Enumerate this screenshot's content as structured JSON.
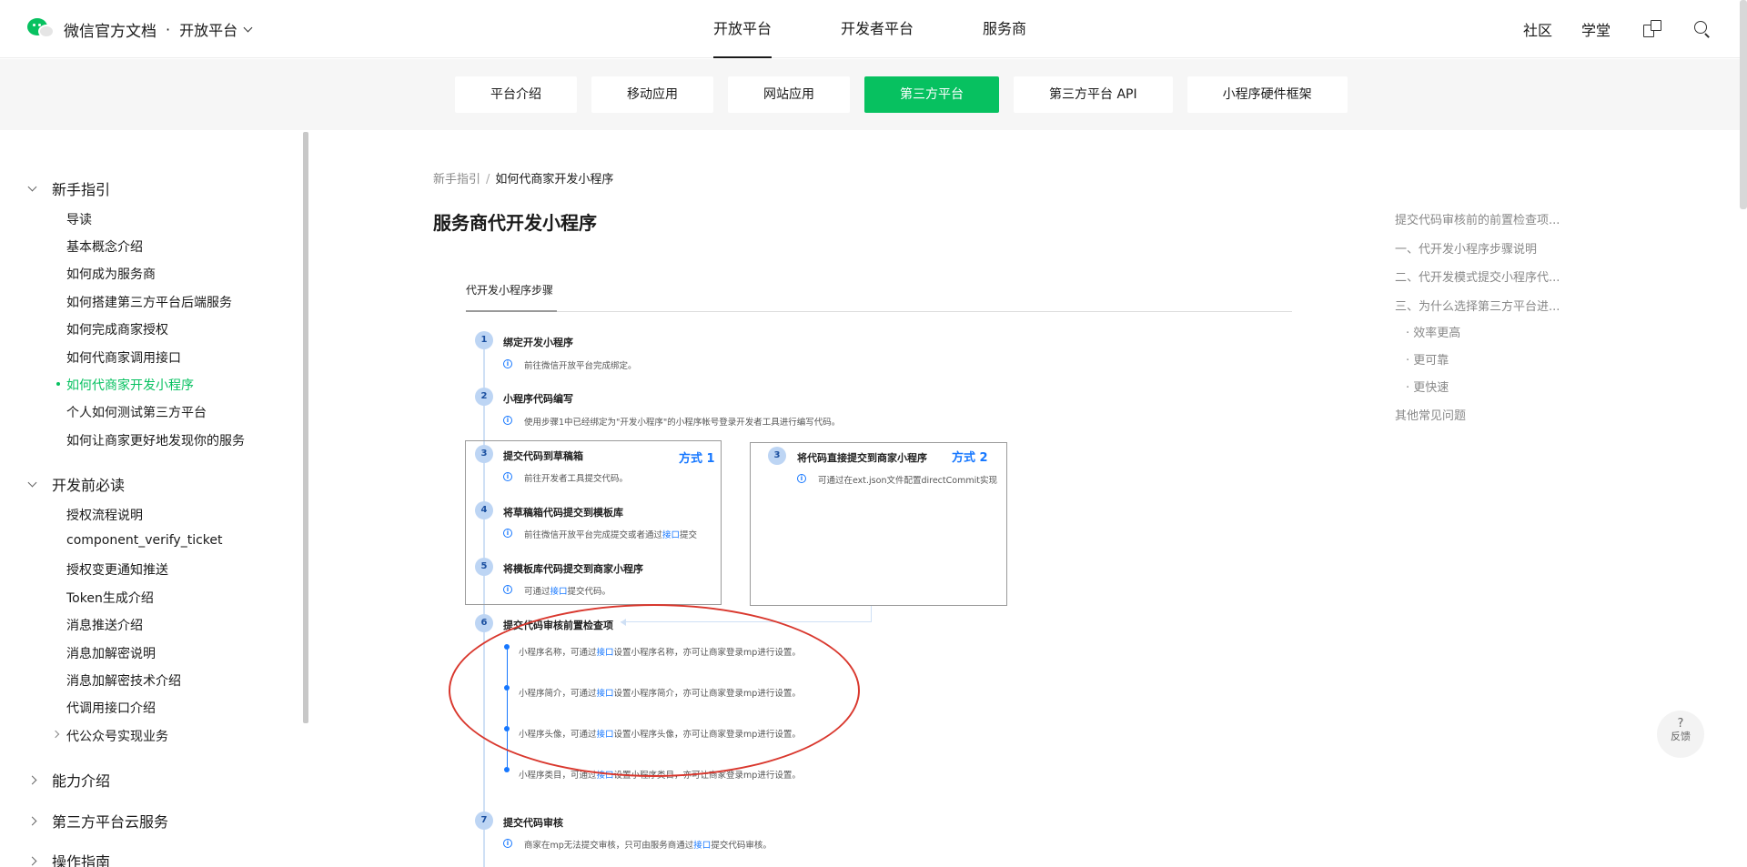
{
  "header": {
    "brand_title": "微信官方文档",
    "brand_sep": "·",
    "platform_switch": "开放平台",
    "nav": [
      "开放平台",
      "开发者平台",
      "服务商"
    ],
    "right_links": [
      "社区",
      "学堂"
    ],
    "icons": [
      "translate-icon",
      "search-icon"
    ]
  },
  "subnav": {
    "tabs": [
      "平台介绍",
      "移动应用",
      "网站应用",
      "第三方平台",
      "第三方平台 API",
      "小程序硬件框架"
    ],
    "active": "第三方平台"
  },
  "sidebar": {
    "groups": [
      {
        "label": "新手指引",
        "expanded": true
      },
      {
        "label": "开发前必读",
        "expanded": true
      },
      {
        "label": "能力介绍",
        "expanded": false
      },
      {
        "label": "第三方平台云服务",
        "expanded": false
      },
      {
        "label": "操作指南",
        "expanded": false
      }
    ],
    "group1_items": [
      "导读",
      "基本概念介绍",
      "如何成为服务商",
      "如何搭建第三方平台后端服务",
      "如何完成商家授权",
      "如何代商家调用接口",
      "如何代商家开发小程序",
      "个人如何测试第三方平台",
      "如何让商家更好地发现你的服务"
    ],
    "group2_items": [
      "授权流程说明",
      "component_verify_ticket",
      "授权变更通知推送",
      "Token生成介绍",
      "消息推送介绍",
      "消息加解密说明",
      "消息加解密技术介绍",
      "代调用接口介绍",
      "代公众号实现业务"
    ],
    "active_item": "如何代商家开发小程序"
  },
  "breadcrumb": {
    "parent": "新手指引",
    "sep": "/",
    "current": "如何代商家开发小程序"
  },
  "page_title": "服务商代开发小程序",
  "diagram": {
    "tab": "代开发小程序步骤",
    "steps": [
      {
        "num": "1",
        "title": "绑定开发小程序",
        "desc": "前往微信开放平台完成绑定。"
      },
      {
        "num": "2",
        "title": "小程序代码编写",
        "desc": "使用步骤1中已经绑定为\"开发小程序\"的小程序帐号登录开发者工具进行编写代码。"
      },
      {
        "num": "3",
        "title": "提交代码到草稿箱",
        "desc": "前往开发者工具提交代码。"
      },
      {
        "num": "4",
        "title": "将草稿箱代码提交到模板库",
        "desc_pre": "前往微信开放平台完成提交或者通过",
        "desc_kw": "接口",
        "desc_post": "提交"
      },
      {
        "num": "5",
        "title": "将模板库代码提交到商家小程序",
        "desc_pre": "可通过",
        "desc_kw": "接口",
        "desc_post": "提交代码。"
      },
      {
        "num": "6",
        "title": "提交代码审核前置检查项"
      },
      {
        "num": "7",
        "title": "提交代码审核",
        "desc_pre": "商家在mp无法提交审核，只可由服务商通过",
        "desc_kw": "接口",
        "desc_post": "提交代码审核。"
      }
    ],
    "way1": "方式 1",
    "way2": "方式 2",
    "alt_step": {
      "num": "3",
      "title": "将代码直接提交到商家小程序",
      "desc": "可通过在ext.json文件配置directCommit实现"
    },
    "checks": [
      {
        "pre": "小程序名称，可通过",
        "kw": "接口",
        "post": "设置小程序名称，亦可让商家登录mp进行设置。"
      },
      {
        "pre": "小程序简介，可通过",
        "kw": "接口",
        "post": "设置小程序简介，亦可让商家登录mp进行设置。"
      },
      {
        "pre": "小程序头像，可通过",
        "kw": "接口",
        "post": "设置小程序头像，亦可让商家登录mp进行设置。"
      },
      {
        "pre": "小程序类目，可通过",
        "kw": "接口",
        "post": "设置小程序类目，亦可让商家登录mp进行设置。"
      }
    ]
  },
  "toc": [
    "提交代码审核前的前置检查项...",
    "一、代开发小程序步骤说明",
    "二、代开发模式提交小程序代...",
    "三、为什么选择第三方平台进...",
    "· 效率更高",
    "· 更可靠",
    "· 更快速",
    "其他常见问题"
  ],
  "feedback": {
    "icon": "?",
    "label": "反馈"
  },
  "colors": {
    "accent": "#07c160",
    "link": "#1677ff",
    "annotation": "#d9382e"
  }
}
